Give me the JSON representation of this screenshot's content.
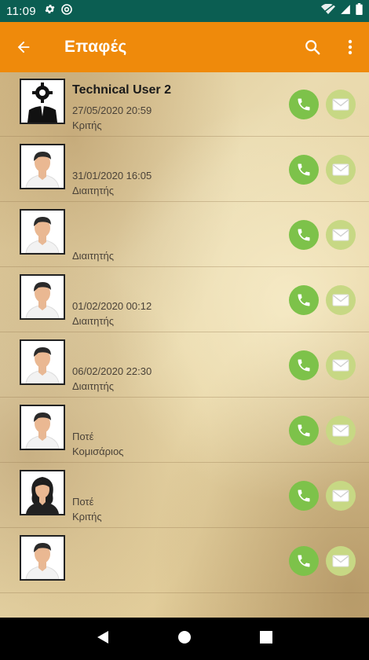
{
  "status_bar": {
    "time": "11:09"
  },
  "app_bar": {
    "title": "Επαφές"
  },
  "contacts": [
    {
      "name": "Technical User 2",
      "date": "27/05/2020 20:59",
      "role": "Κριτής",
      "avatar": "settings-avatar"
    },
    {
      "name": "",
      "date": "31/01/2020 16:05",
      "role": "Διαιτητής",
      "avatar": "male-avatar"
    },
    {
      "name": "",
      "date": "",
      "role": "Διαιτητής",
      "avatar": "male-avatar"
    },
    {
      "name": "",
      "date": "01/02/2020 00:12",
      "role": "Διαιτητής",
      "avatar": "male-avatar"
    },
    {
      "name": "",
      "date": "06/02/2020 22:30",
      "role": "Διαιτητής",
      "avatar": "male-avatar"
    },
    {
      "name": "",
      "date": "Ποτέ",
      "role": "Κομισάριος",
      "avatar": "male-avatar"
    },
    {
      "name": "",
      "date": "Ποτέ",
      "role": "Κριτής",
      "avatar": "female-avatar"
    },
    {
      "name": "",
      "date": "",
      "role": "",
      "avatar": "male-avatar"
    }
  ],
  "colors": {
    "status_bar": "#0b5e52",
    "app_bar": "#ef8a0b",
    "call": "#7dc24a",
    "mail": "#c7d884"
  }
}
